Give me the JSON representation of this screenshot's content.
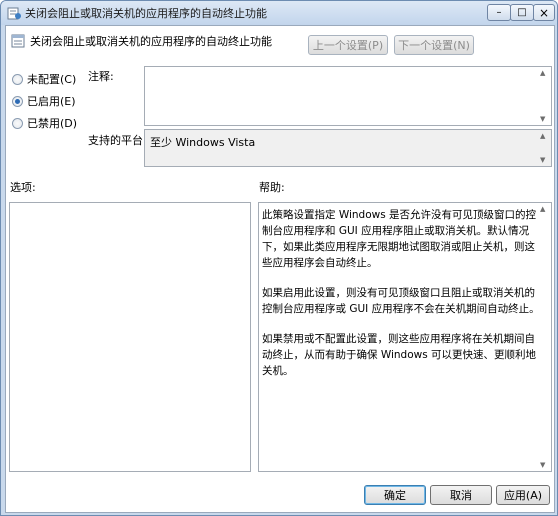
{
  "window": {
    "title": "关闭会阻止或取消关机的应用程序的自动终止功能",
    "controls": {
      "minimize": "–",
      "maximize": "□",
      "close": "×"
    }
  },
  "header": {
    "title": "关闭会阻止或取消关机的应用程序的自动终止功能",
    "prev_label": "上一个设置(P)",
    "next_label": "下一个设置(N)"
  },
  "options": [
    {
      "label": "未配置(C)",
      "checked": false
    },
    {
      "label": "已启用(E)",
      "checked": true
    },
    {
      "label": "已禁用(D)",
      "checked": false
    }
  ],
  "comment": {
    "label": "注释:",
    "value": ""
  },
  "platform": {
    "label": "支持的平台:",
    "value": "至少 Windows Vista"
  },
  "sections": {
    "options_label": "选项:",
    "help_label": "帮助:"
  },
  "help": {
    "paragraphs": [
      "此策略设置指定 Windows 是否允许没有可见顶级窗口的控制台应用程序和 GUI 应用程序阻止或取消关机。默认情况下，如果此类应用程序无限期地试图取消或阻止关机，则这些应用程序会自动终止。",
      "如果启用此设置，则没有可见顶级窗口且阻止或取消关机的控制台应用程序或 GUI 应用程序不会在关机期间自动终止。",
      "如果禁用或不配置此设置，则这些应用程序将在关机期间自动终止，从而有助于确保 Windows 可以更快速、更顺利地关机。"
    ]
  },
  "footer": {
    "ok": "确定",
    "cancel": "取消",
    "apply": "应用(A)"
  }
}
